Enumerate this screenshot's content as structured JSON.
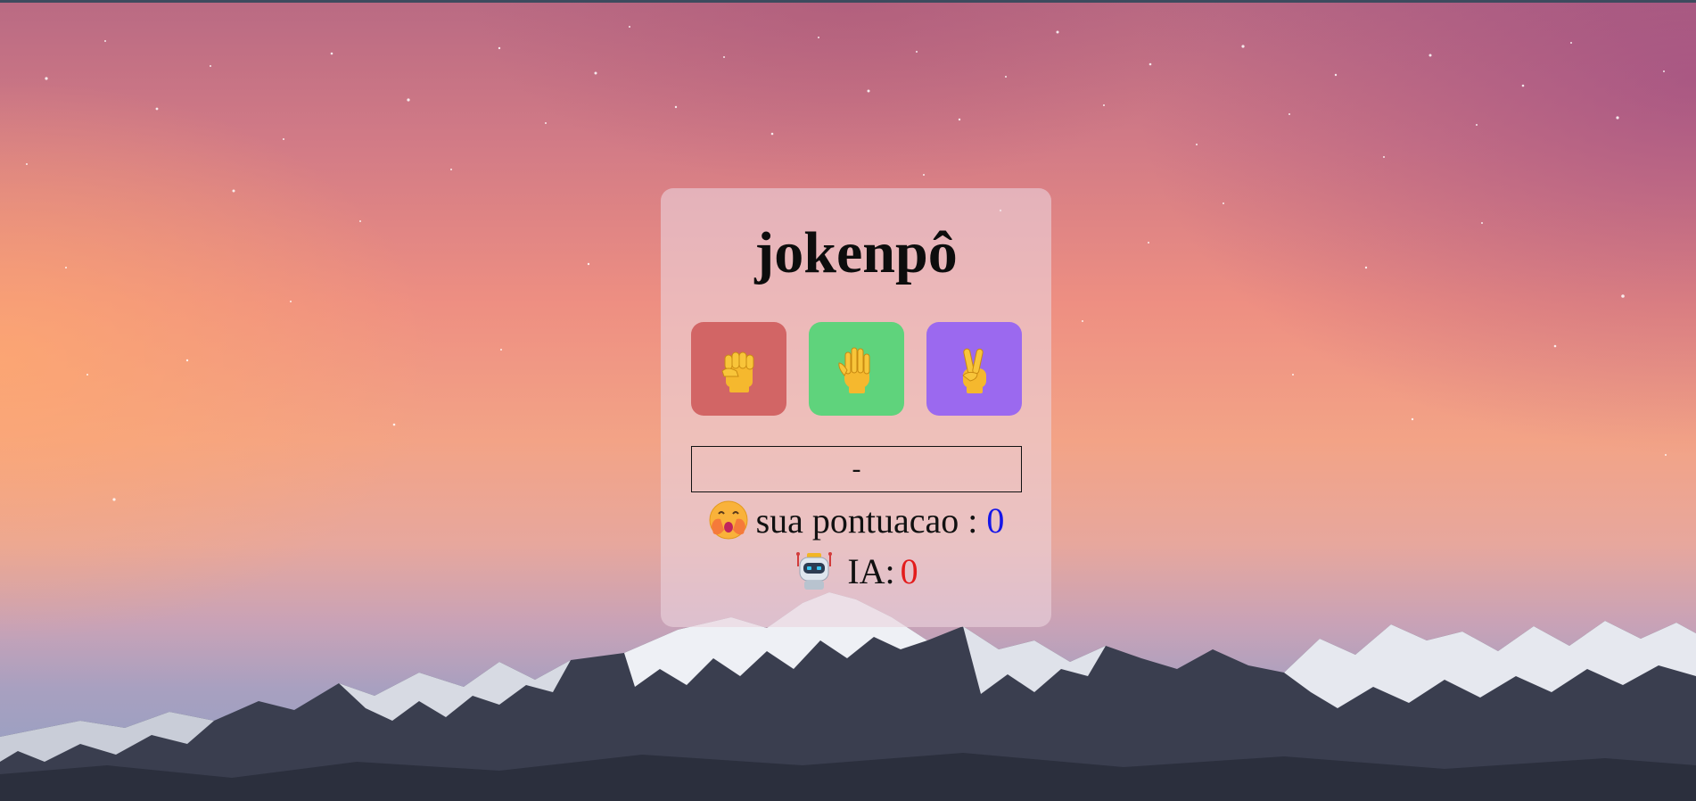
{
  "game": {
    "title": "jokenpô",
    "choices": [
      {
        "name": "rock",
        "icon": "raised-fist-icon",
        "color": "#d26565"
      },
      {
        "name": "paper",
        "icon": "raised-hand-icon",
        "color": "#5fd37c"
      },
      {
        "name": "scissors",
        "icon": "victory-hand-icon",
        "color": "#9b69ef"
      }
    ],
    "result": "-",
    "player": {
      "icon": "face-with-hand-over-mouth-icon",
      "label": "sua pontuacao :",
      "score": "0",
      "score_color": "#1515e8"
    },
    "ai": {
      "icon": "robot-icon",
      "label": "IA:",
      "score": "0",
      "score_color": "#e31b1b"
    }
  }
}
